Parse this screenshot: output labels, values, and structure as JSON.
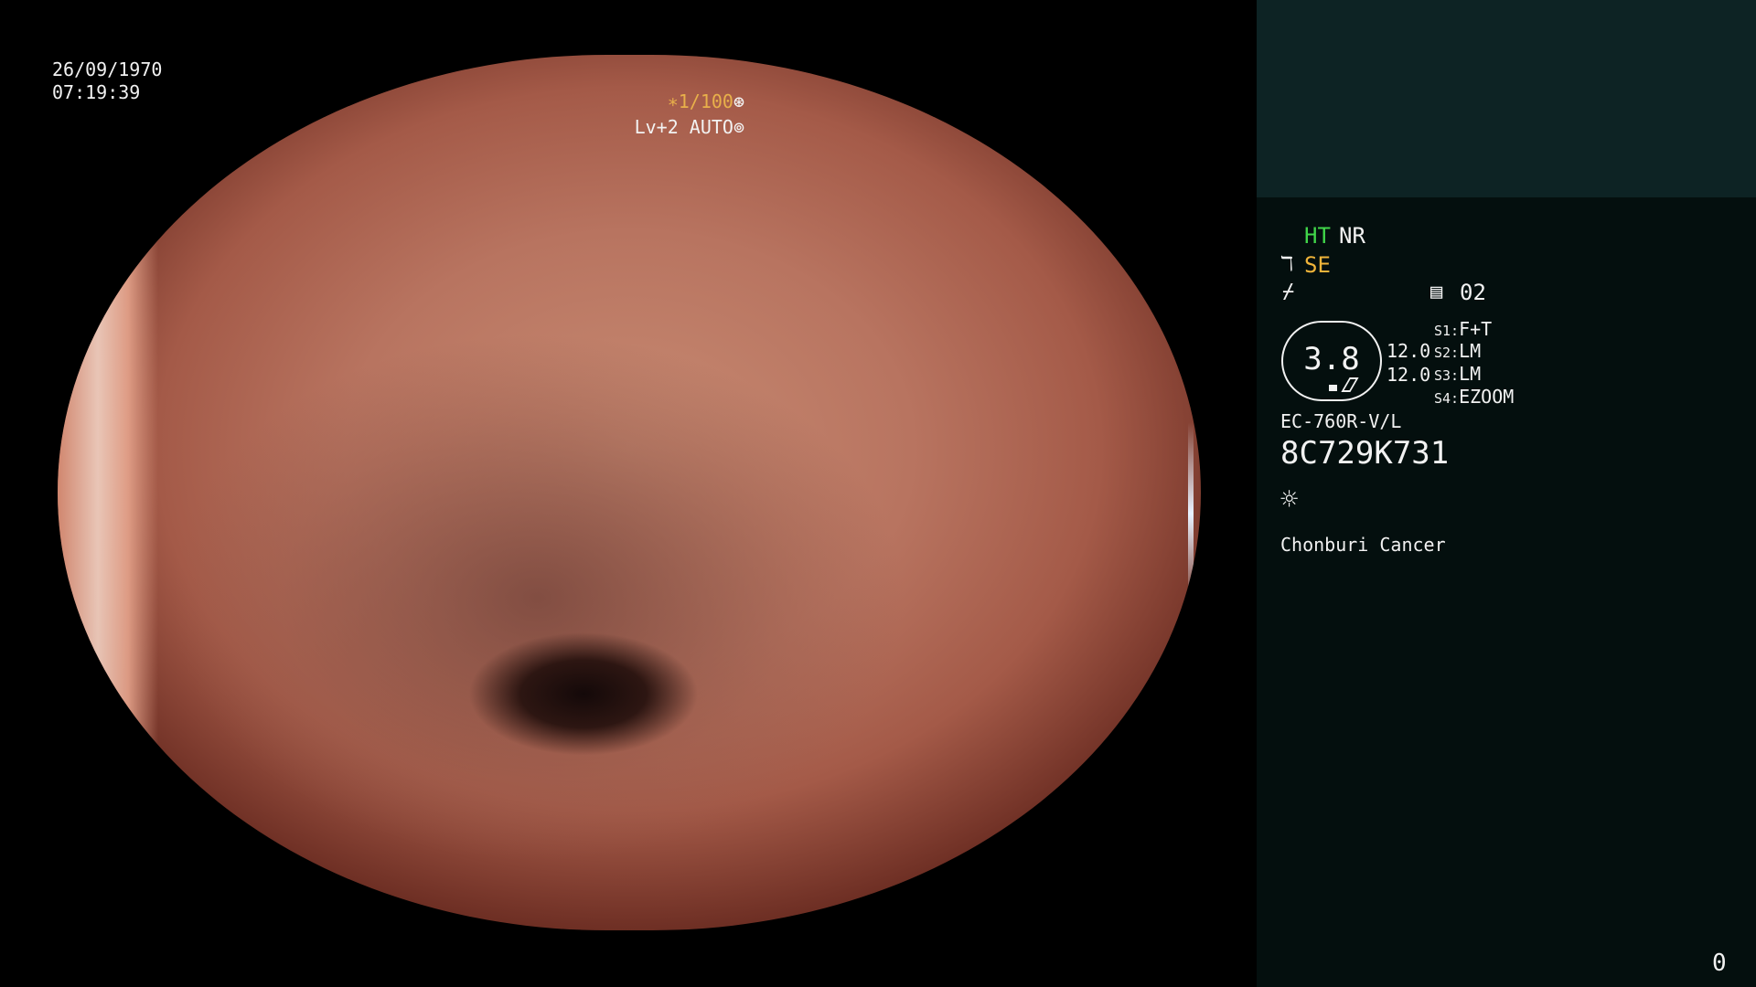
{
  "overlay": {
    "date": "26/09/1970",
    "time": "07:19:39",
    "shutter_value": "∗1/100",
    "shutter_icon": "⊛",
    "level_text": "Lv+2 AUTO",
    "level_icon": "⊚"
  },
  "panel": {
    "ht_label": "HT",
    "nr_label": "NR",
    "se_icon": "ℸ",
    "se_label": "SE",
    "enhance_icon": "⌿",
    "memory_icon": "▤",
    "memory_value": "02",
    "zoom": {
      "value": "3.8",
      "value_1": "12.0",
      "value_2": "12.0"
    },
    "switches": [
      {
        "key": "S1:",
        "value": "F+T"
      },
      {
        "key": "S2:",
        "value": "LM"
      },
      {
        "key": "S3:",
        "value": "LM"
      },
      {
        "key": "S4:",
        "value": "EZOOM"
      }
    ],
    "scope_model": "EC-760R-V/L",
    "scope_serial": "8C729K731",
    "light_icon": "☼",
    "hospital": "Chonburi Cancer",
    "frame_counter": "0"
  },
  "colors": {
    "ht": "#41d64a",
    "se": "#f0b43a",
    "shutter": "#e8b04a",
    "panel_top": "#0d2324",
    "panel_bg": "#040f0e"
  }
}
